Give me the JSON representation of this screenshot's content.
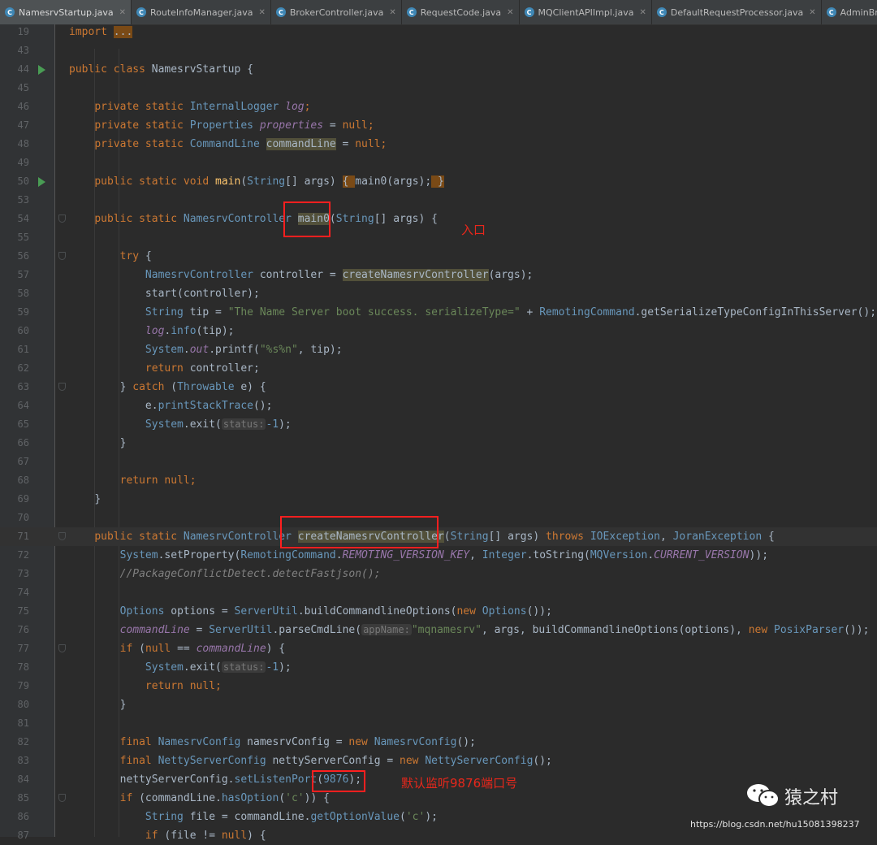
{
  "tabs": [
    {
      "label": "NamesrvStartup.java",
      "active": true
    },
    {
      "label": "RouteInfoManager.java",
      "active": false
    },
    {
      "label": "BrokerController.java",
      "active": false
    },
    {
      "label": "RequestCode.java",
      "active": false
    },
    {
      "label": "MQClientAPIImpl.java",
      "active": false
    },
    {
      "label": "DefaultRequestProcessor.java",
      "active": false
    },
    {
      "label": "AdminBrokerProcessor.java",
      "active": false
    }
  ],
  "lines": [
    {
      "n": "19",
      "indent": "",
      "tokens": [
        [
          "k",
          "import "
        ],
        [
          "fb",
          "..."
        ]
      ]
    },
    {
      "n": "43",
      "indent": "",
      "tokens": []
    },
    {
      "n": "44",
      "run": true,
      "indent": "",
      "tokens": [
        [
          "k",
          "public class "
        ],
        [
          "i",
          "NamesrvStartup {"
        ]
      ]
    },
    {
      "n": "45",
      "indent": "",
      "tokens": []
    },
    {
      "n": "46",
      "indent": "    ",
      "tokens": [
        [
          "k",
          "private static "
        ],
        [
          "t",
          "InternalLogger "
        ],
        [
          "f",
          "log"
        ],
        [
          "k",
          ";"
        ]
      ]
    },
    {
      "n": "47",
      "indent": "    ",
      "tokens": [
        [
          "k",
          "private static "
        ],
        [
          "t",
          "Properties "
        ],
        [
          "f",
          "properties"
        ],
        [
          "i",
          " = "
        ],
        [
          "k",
          "null;"
        ]
      ]
    },
    {
      "n": "48",
      "indent": "    ",
      "tokens": [
        [
          "k",
          "private static "
        ],
        [
          "t",
          "CommandLine "
        ],
        [
          "hl",
          "commandLine"
        ],
        [
          "i",
          " = "
        ],
        [
          "k",
          "null;"
        ]
      ]
    },
    {
      "n": "49",
      "indent": "",
      "tokens": []
    },
    {
      "n": "50",
      "run": true,
      "indent": "    ",
      "tokens": [
        [
          "k",
          "public static void "
        ],
        [
          "m",
          "main"
        ],
        [
          "i",
          "("
        ],
        [
          "t",
          "String"
        ],
        [
          "i",
          "[] args) "
        ],
        [
          "fb",
          "{ "
        ],
        [
          "i",
          "main0(args);"
        ],
        [
          "fb",
          " }"
        ]
      ]
    },
    {
      "n": "53",
      "indent": "",
      "tokens": []
    },
    {
      "n": "54",
      "fold": true,
      "indent": "    ",
      "tokens": [
        [
          "k",
          "public static "
        ],
        [
          "t",
          "NamesrvController "
        ],
        [
          "hl",
          "main0"
        ],
        [
          "i",
          "("
        ],
        [
          "t",
          "String"
        ],
        [
          "i",
          "[] args) {"
        ]
      ]
    },
    {
      "n": "55",
      "indent": "",
      "tokens": []
    },
    {
      "n": "56",
      "fold": true,
      "indent": "        ",
      "tokens": [
        [
          "k",
          "try "
        ],
        [
          "i",
          "{"
        ]
      ]
    },
    {
      "n": "57",
      "indent": "            ",
      "tokens": [
        [
          "t",
          "NamesrvController "
        ],
        [
          "i",
          "controller = "
        ],
        [
          "hl",
          "createNamesrvController"
        ],
        [
          "i",
          "(args);"
        ]
      ]
    },
    {
      "n": "58",
      "indent": "            ",
      "tokens": [
        [
          "i",
          "start(controller);"
        ]
      ]
    },
    {
      "n": "59",
      "indent": "            ",
      "tokens": [
        [
          "t",
          "String "
        ],
        [
          "i",
          "tip = "
        ],
        [
          "s",
          "\"The Name Server boot success. serializeType=\""
        ],
        [
          "i",
          " + "
        ],
        [
          "t",
          "RemotingCommand"
        ],
        [
          "i",
          ".getSerializeTypeConfigInThisServer();"
        ]
      ]
    },
    {
      "n": "60",
      "indent": "            ",
      "tokens": [
        [
          "f",
          "log"
        ],
        [
          "i",
          "."
        ],
        [
          "t",
          "info"
        ],
        [
          "i",
          "(tip);"
        ]
      ]
    },
    {
      "n": "61",
      "indent": "            ",
      "tokens": [
        [
          "t",
          "System"
        ],
        [
          "i",
          "."
        ],
        [
          "f",
          "out"
        ],
        [
          "i",
          ".printf("
        ],
        [
          "s",
          "\"%s%n\""
        ],
        [
          "i",
          ", tip);"
        ]
      ]
    },
    {
      "n": "62",
      "indent": "            ",
      "tokens": [
        [
          "k",
          "return "
        ],
        [
          "i",
          "controller;"
        ]
      ]
    },
    {
      "n": "63",
      "fold": true,
      "indent": "        ",
      "tokens": [
        [
          "i",
          "} "
        ],
        [
          "k",
          "catch "
        ],
        [
          "i",
          "("
        ],
        [
          "t",
          "Throwable "
        ],
        [
          "i",
          "e) {"
        ]
      ]
    },
    {
      "n": "64",
      "indent": "            ",
      "tokens": [
        [
          "i",
          "e."
        ],
        [
          "t",
          "printStackTrace"
        ],
        [
          "i",
          "();"
        ]
      ]
    },
    {
      "n": "65",
      "indent": "            ",
      "tokens": [
        [
          "t",
          "System"
        ],
        [
          "i",
          ".exit("
        ],
        [
          "hint",
          "status:"
        ],
        [
          "t",
          "-1"
        ],
        [
          "i",
          ");"
        ]
      ]
    },
    {
      "n": "66",
      "indent": "        ",
      "tokens": [
        [
          "i",
          "}"
        ]
      ]
    },
    {
      "n": "67",
      "indent": "",
      "tokens": []
    },
    {
      "n": "68",
      "indent": "        ",
      "tokens": [
        [
          "k",
          "return null;"
        ]
      ]
    },
    {
      "n": "69",
      "indent": "    ",
      "tokens": [
        [
          "i",
          "}"
        ]
      ]
    },
    {
      "n": "70",
      "indent": "",
      "tokens": []
    },
    {
      "n": "71",
      "fold": true,
      "cur": true,
      "indent": "    ",
      "tokens": [
        [
          "k",
          "public static "
        ],
        [
          "t",
          "NamesrvController "
        ],
        [
          "hl",
          "createNamesrvController"
        ],
        [
          "i",
          "("
        ],
        [
          "t",
          "String"
        ],
        [
          "i",
          "[] args) "
        ],
        [
          "k",
          "throws "
        ],
        [
          "t",
          "IOException"
        ],
        [
          "i",
          ", "
        ],
        [
          "t",
          "JoranException"
        ],
        [
          "i",
          " {"
        ]
      ]
    },
    {
      "n": "72",
      "indent": "        ",
      "tokens": [
        [
          "t",
          "System"
        ],
        [
          "i",
          ".setProperty("
        ],
        [
          "t",
          "RemotingCommand"
        ],
        [
          "i",
          "."
        ],
        [
          "f",
          "REMOTING_VERSION_KEY"
        ],
        [
          "i",
          ", "
        ],
        [
          "t",
          "Integer"
        ],
        [
          "i",
          ".toString("
        ],
        [
          "t",
          "MQVersion"
        ],
        [
          "i",
          "."
        ],
        [
          "f",
          "CURRENT_VERSION"
        ],
        [
          "i",
          "));"
        ]
      ]
    },
    {
      "n": "73",
      "indent": "        ",
      "tokens": [
        [
          "c",
          "//PackageConflictDetect.detectFastjson();"
        ]
      ]
    },
    {
      "n": "74",
      "indent": "",
      "tokens": []
    },
    {
      "n": "75",
      "indent": "        ",
      "tokens": [
        [
          "t",
          "Options "
        ],
        [
          "i",
          "options = "
        ],
        [
          "t",
          "ServerUtil"
        ],
        [
          "i",
          ".buildCommandlineOptions("
        ],
        [
          "k",
          "new "
        ],
        [
          "t",
          "Options"
        ],
        [
          "i",
          "());"
        ]
      ]
    },
    {
      "n": "76",
      "indent": "        ",
      "tokens": [
        [
          "f",
          "commandLine"
        ],
        [
          "i",
          " = "
        ],
        [
          "t",
          "ServerUtil"
        ],
        [
          "i",
          ".parseCmdLine("
        ],
        [
          "hint",
          "appName:"
        ],
        [
          "s",
          "\"mqnamesrv\""
        ],
        [
          "i",
          ", args, buildCommandlineOptions(options), "
        ],
        [
          "k",
          "new "
        ],
        [
          "t",
          "PosixParser"
        ],
        [
          "i",
          "());"
        ]
      ]
    },
    {
      "n": "77",
      "fold": true,
      "indent": "        ",
      "tokens": [
        [
          "k",
          "if "
        ],
        [
          "i",
          "("
        ],
        [
          "k",
          "null"
        ],
        [
          "i",
          " == "
        ],
        [
          "f",
          "commandLine"
        ],
        [
          "i",
          ") {"
        ]
      ]
    },
    {
      "n": "78",
      "indent": "            ",
      "tokens": [
        [
          "t",
          "System"
        ],
        [
          "i",
          ".exit("
        ],
        [
          "hint",
          "status:"
        ],
        [
          "t",
          "-1"
        ],
        [
          "i",
          ");"
        ]
      ]
    },
    {
      "n": "79",
      "indent": "            ",
      "tokens": [
        [
          "k",
          "return null;"
        ]
      ]
    },
    {
      "n": "80",
      "indent": "        ",
      "tokens": [
        [
          "i",
          "}"
        ]
      ]
    },
    {
      "n": "81",
      "indent": "",
      "tokens": []
    },
    {
      "n": "82",
      "indent": "        ",
      "tokens": [
        [
          "k",
          "final "
        ],
        [
          "t",
          "NamesrvConfig "
        ],
        [
          "i",
          "namesrvConfig = "
        ],
        [
          "k",
          "new "
        ],
        [
          "t",
          "NamesrvConfig"
        ],
        [
          "i",
          "();"
        ]
      ]
    },
    {
      "n": "83",
      "indent": "        ",
      "tokens": [
        [
          "k",
          "final "
        ],
        [
          "t",
          "NettyServerConfig "
        ],
        [
          "i",
          "nettyServerConfig = "
        ],
        [
          "k",
          "new "
        ],
        [
          "t",
          "NettyServerConfig"
        ],
        [
          "i",
          "();"
        ]
      ]
    },
    {
      "n": "84",
      "indent": "        ",
      "tokens": [
        [
          "i",
          "nettyServerConfig."
        ],
        [
          "t",
          "setListenPort"
        ],
        [
          "i",
          "("
        ],
        [
          "t",
          "9876"
        ],
        [
          "i",
          ");"
        ]
      ]
    },
    {
      "n": "85",
      "fold": true,
      "indent": "        ",
      "tokens": [
        [
          "k",
          "if "
        ],
        [
          "i",
          "(commandLine."
        ],
        [
          "t",
          "hasOption"
        ],
        [
          "i",
          "("
        ],
        [
          "s",
          "'c'"
        ],
        [
          "i",
          ")) {"
        ]
      ]
    },
    {
      "n": "86",
      "indent": "            ",
      "tokens": [
        [
          "t",
          "String "
        ],
        [
          "i",
          "file = commandLine."
        ],
        [
          "t",
          "getOptionValue"
        ],
        [
          "i",
          "("
        ],
        [
          "s",
          "'c'"
        ],
        [
          "i",
          ");"
        ]
      ]
    },
    {
      "n": "87",
      "indent": "            ",
      "tokens": [
        [
          "k",
          "if "
        ],
        [
          "i",
          "(file != "
        ],
        [
          "k",
          "null"
        ],
        [
          "i",
          ") {"
        ]
      ]
    }
  ],
  "annotations": {
    "entry_label": "入口",
    "port_label": "默认监听9876端口号"
  },
  "watermark": {
    "name": "猿之村",
    "url": "https://blog.csdn.net/hu15081398237"
  }
}
